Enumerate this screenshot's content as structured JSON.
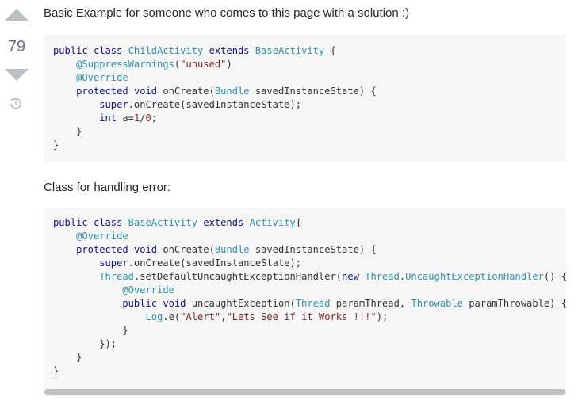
{
  "vote": {
    "count": "79",
    "upvote_icon": "arrow-up-icon",
    "downvote_icon": "arrow-down-icon",
    "history_icon": "history-icon"
  },
  "post": {
    "intro_text": "Basic Example for someone who comes to this page with a solution :)",
    "second_text": "Class for handling error:"
  },
  "code_block_1": {
    "lines": [
      "public class ChildActivity extends BaseActivity {",
      "    @SuppressWarnings(\"unused\")",
      "    @Override",
      "    protected void onCreate(Bundle savedInstanceState) {",
      "        super.onCreate(savedInstanceState);",
      "        int a=1/0;",
      "    }",
      "}"
    ]
  },
  "code_block_2": {
    "lines": [
      "public class BaseActivity extends Activity{",
      "    @Override",
      "    protected void onCreate(Bundle savedInstanceState) {",
      "        super.onCreate(savedInstanceState);",
      "        Thread.setDefaultUncaughtExceptionHandler(new Thread.UncaughtExceptionHandler() {",
      "            @Override",
      "            public void uncaughtException(Thread paramThread, Throwable paramThrowable) {",
      "                Log.e(\"Alert\",\"Lets See if it Works !!!\");",
      "            }",
      "        });",
      "    }",
      "}"
    ]
  },
  "colors": {
    "keyword": "#101094",
    "type": "#2b91af",
    "string": "#7d2727",
    "code_background": "#f6f6f6",
    "vote_arrow": "#bbc0c4"
  }
}
